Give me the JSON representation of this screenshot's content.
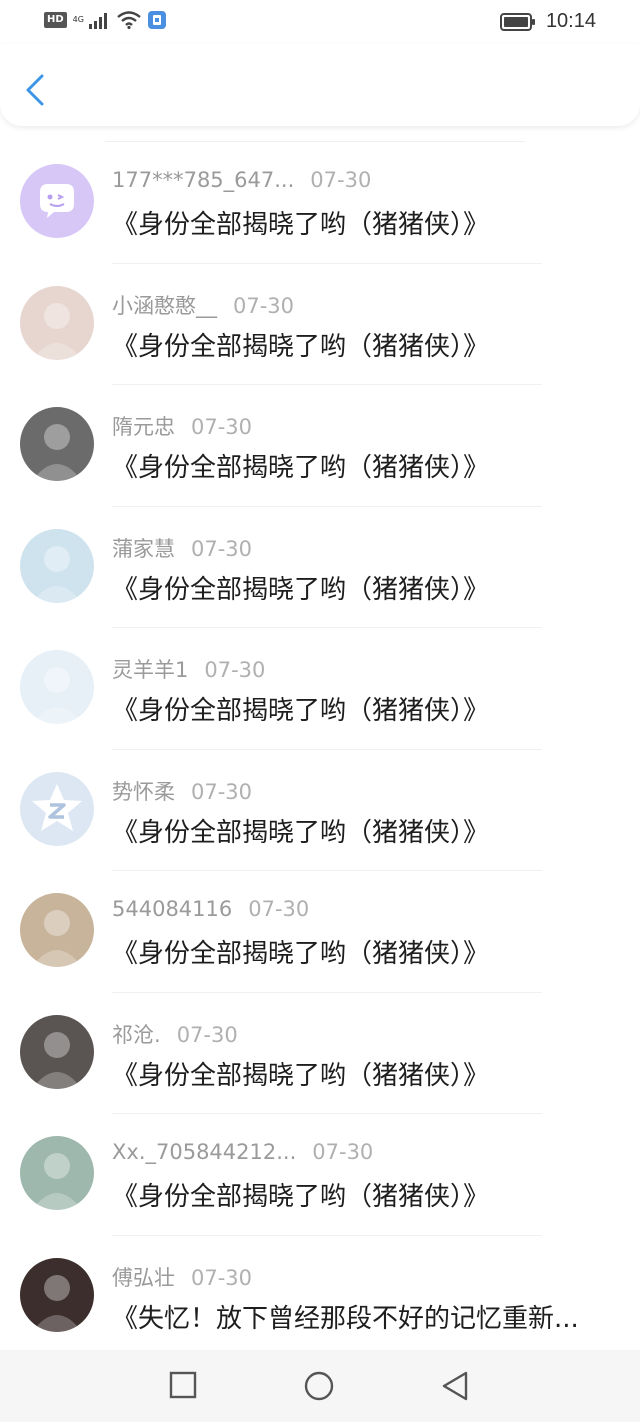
{
  "status_bar": {
    "hd": "HD",
    "network": "4G",
    "time": "10:14",
    "icons": [
      "signal-icon",
      "wifi-icon",
      "sim-icon",
      "battery-icon"
    ]
  },
  "header": {
    "back_icon": "chevron-left-icon",
    "accent": "#3d95e8"
  },
  "items": [
    {
      "name": "177***785_647...",
      "date": "07-30",
      "title": "《身份全部揭晓了哟（猪猪侠）》",
      "avatar": "chat-bubble-avatar",
      "avatar_color": "#d7c7f7"
    },
    {
      "name": "小涵憨憨__",
      "date": "07-30",
      "title": "《身份全部揭晓了哟（猪猪侠）》",
      "avatar": "photo-avatar",
      "avatar_color": "#e6d6cf"
    },
    {
      "name": "隋元忠",
      "date": "07-30",
      "title": "《身份全部揭晓了哟（猪猪侠）》",
      "avatar": "photo-avatar",
      "avatar_color": "#6b6b6b"
    },
    {
      "name": "蒲家慧",
      "date": "07-30",
      "title": "《身份全部揭晓了哟（猪猪侠）》",
      "avatar": "photo-avatar",
      "avatar_color": "#cfe3ee"
    },
    {
      "name": "灵羊羊1",
      "date": "07-30",
      "title": "《身份全部揭晓了哟（猪猪侠）》",
      "avatar": "photo-avatar",
      "avatar_color": "#e7f0f7"
    },
    {
      "name": "势怀柔",
      "date": "07-30",
      "title": "《身份全部揭晓了哟（猪猪侠）》",
      "avatar": "z-logo-avatar",
      "avatar_color": "#dde7f3"
    },
    {
      "name": "544084116",
      "date": "07-30",
      "title": "《身份全部揭晓了哟（猪猪侠）》",
      "avatar": "photo-avatar",
      "avatar_color": "#c8b49b"
    },
    {
      "name": "祁沧.",
      "date": "07-30",
      "title": "《身份全部揭晓了哟（猪猪侠）》",
      "avatar": "photo-avatar",
      "avatar_color": "#5a5452"
    },
    {
      "name": "Xx._705844212...",
      "date": "07-30",
      "title": "《身份全部揭晓了哟（猪猪侠）》",
      "avatar": "photo-avatar",
      "avatar_color": "#9fb8ad"
    },
    {
      "name": "傅弘壮",
      "date": "07-30",
      "title": "《失忆！放下曾经那段不好的记忆重新...",
      "avatar": "photo-avatar",
      "avatar_color": "#3b2e2c"
    }
  ],
  "nav": {
    "buttons": [
      "recent-apps-icon",
      "home-icon",
      "back-icon"
    ]
  }
}
